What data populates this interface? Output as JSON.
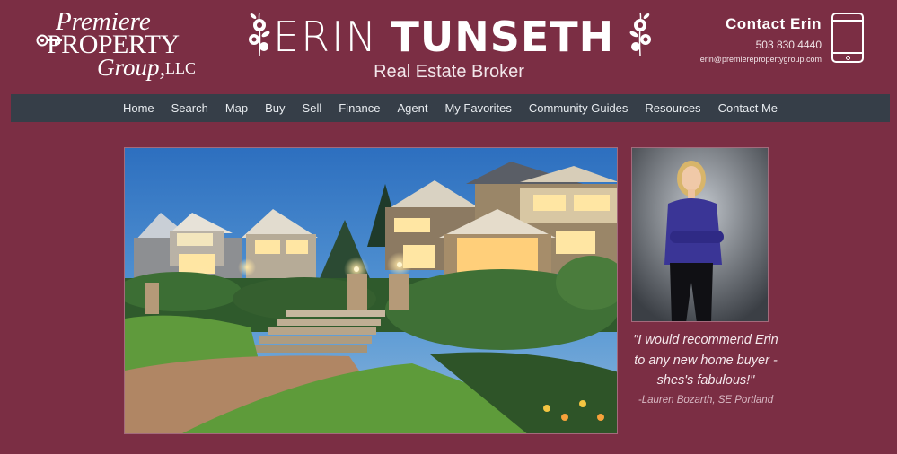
{
  "logo": {
    "line1": "Premiere",
    "line2": "PROPERTY",
    "line3": "Group,",
    "line4": "LLC"
  },
  "brand": {
    "first": "ERIN",
    "last": "TUNSETH",
    "subtitle": "Real Estate Broker"
  },
  "contact": {
    "title": "Contact Erin",
    "phone": "503 830 4440",
    "email": "erin@premierepropertygroup.com"
  },
  "nav": {
    "items": [
      "Home",
      "Search",
      "Map",
      "Buy",
      "Sell",
      "Finance",
      "Agent",
      "My Favorites",
      "Community Guides",
      "Resources",
      "Contact Me"
    ]
  },
  "testimonial": {
    "quote": "\"I would recommend Erin to any new home buyer - shes's fabulous!\"",
    "author": "-Lauren Bozarth, SE Portland"
  },
  "icons": {
    "phone": "smartphone-icon",
    "key": "key-icon",
    "flower": "rose-ornament-icon"
  },
  "colors": {
    "background": "#7b2e44",
    "nav": "#363e48"
  }
}
